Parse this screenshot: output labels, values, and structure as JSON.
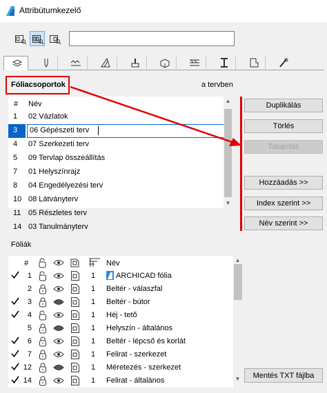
{
  "window": {
    "title": "Attribútumkezelő"
  },
  "toolbar": {
    "search_value": ""
  },
  "tabs": [
    {
      "name": "layers-tab",
      "icon": "layers-icon"
    },
    {
      "name": "pen-tab",
      "icon": "pen-icon"
    },
    {
      "name": "line-tab",
      "icon": "line-type-icon"
    },
    {
      "name": "fill-tab",
      "icon": "fill-icon"
    },
    {
      "name": "surface-tab",
      "icon": "surface-brush-icon"
    },
    {
      "name": "material-tab",
      "icon": "building-material-icon"
    },
    {
      "name": "composite-tab",
      "icon": "composite-icon"
    },
    {
      "name": "profile-tab",
      "icon": "profile-icon"
    },
    {
      "name": "zone-tab",
      "icon": "zone-category-icon"
    },
    {
      "name": "mep-tab",
      "icon": "mep-icon"
    }
  ],
  "group": {
    "title": "Fóliacsoportok",
    "in_plan": "a tervben",
    "col_num": "#",
    "col_name": "Név",
    "rows": [
      {
        "num": "1",
        "name": "02 Vázlatok"
      },
      {
        "num": "3",
        "name": "06 Gépészeti terv",
        "selected": true
      },
      {
        "num": "4",
        "name": "07 Szerkezeti terv"
      },
      {
        "num": "5",
        "name": "09 Tervlap összeállítás"
      },
      {
        "num": "7",
        "name": "01 Helyszínrajz"
      },
      {
        "num": "8",
        "name": "04 Engedélyezési terv"
      },
      {
        "num": "10",
        "name": "08 Látványterv"
      },
      {
        "num": "11",
        "name": "05 Részletes terv"
      },
      {
        "num": "14",
        "name": "03 Tanulmányterv"
      }
    ]
  },
  "buttons": {
    "duplicate": "Duplikálás",
    "delete": "Törlés",
    "purge": "Takarítás",
    "add": "Hozzáadás >>",
    "by_index": "Index szerint >>",
    "by_name": "Név szerint >>",
    "save_txt": "Mentés TXT fájlba"
  },
  "layers": {
    "title": "Fóliák",
    "col_num": "#",
    "col_name": "Név",
    "rows": [
      {
        "checked": true,
        "num": "1",
        "locked": false,
        "visible": true,
        "pen": "1",
        "name": "ARCHICAD fólia",
        "archicad_icon": true
      },
      {
        "checked": false,
        "num": "2",
        "locked": true,
        "visible": true,
        "pen": "1",
        "name": "Beltér - válaszfal"
      },
      {
        "checked": true,
        "num": "3",
        "locked": true,
        "visible": false,
        "pen": "1",
        "name": "Beltér - bútor"
      },
      {
        "checked": true,
        "num": "4",
        "locked": false,
        "visible": true,
        "pen": "1",
        "name": "Héj - tető"
      },
      {
        "checked": false,
        "num": "5",
        "locked": true,
        "visible": false,
        "pen": "1",
        "name": "Helyszín - általános"
      },
      {
        "checked": true,
        "num": "6",
        "locked": true,
        "visible": true,
        "pen": "1",
        "name": "Beltér - lépcső és korlát"
      },
      {
        "checked": true,
        "num": "7",
        "locked": true,
        "visible": true,
        "pen": "1",
        "name": "Felirat - szerkezet"
      },
      {
        "checked": true,
        "num": "12",
        "locked": true,
        "visible": false,
        "pen": "1",
        "name": "Méretezés - szerkezet"
      },
      {
        "checked": true,
        "num": "14",
        "locked": true,
        "visible": true,
        "pen": "1",
        "name": "Felirat - általános"
      }
    ]
  },
  "colors": {
    "accent": "#0a64c8",
    "annotation_red": "#e00000"
  }
}
